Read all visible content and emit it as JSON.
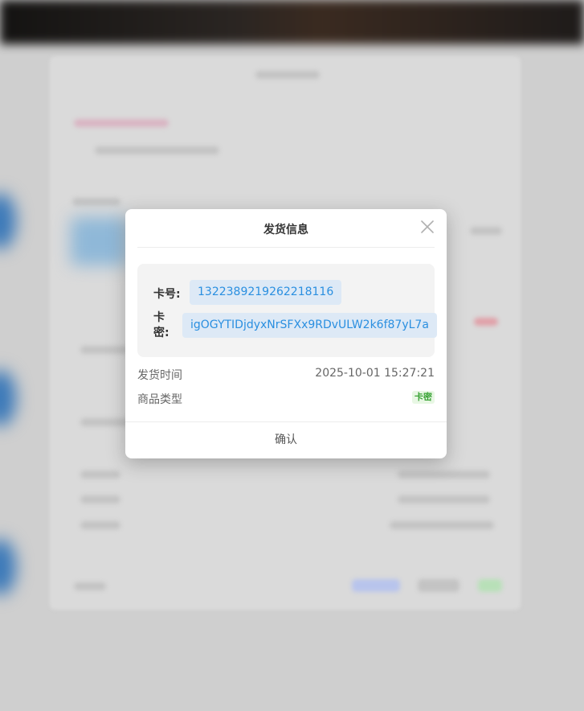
{
  "dialog": {
    "title": "发货信息",
    "card_number_label": "卡号:",
    "card_number": "1322389219262218116",
    "card_secret_label": "卡密:",
    "card_secret": "igOGYTIDjdyxNrSFXx9RDvULW2k6f87yL7a",
    "ship_time_label": "发货时间",
    "ship_time": "2025-10-01 15:27:21",
    "product_type_label": "商品类型",
    "product_type": "卡密",
    "confirm_label": "确认"
  },
  "colors": {
    "chip_bg": "#dde9f6",
    "chip_text": "#2a8fe0",
    "tag_bg": "#e8f7e4",
    "tag_text": "#3aa336"
  },
  "icons": {
    "close": "close-icon"
  }
}
